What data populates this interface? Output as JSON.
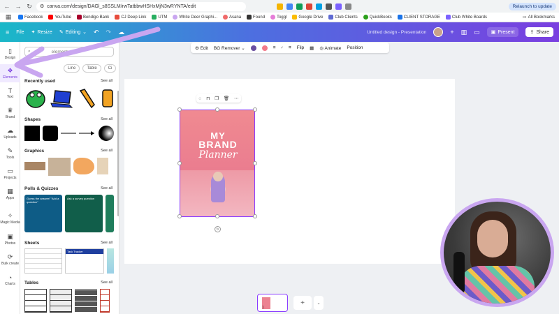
{
  "browser": {
    "url": "canva.com/design/DAGl_s8SSLM/rwTatbbwHSHxMjN3wRYNTA/edit",
    "relaunch": "Relaunch to update",
    "bookmarks": [
      {
        "label": "Facebook",
        "color": "#1877f2"
      },
      {
        "label": "YouTube",
        "color": "#ff0000"
      },
      {
        "label": "Bendigo Bank",
        "color": "#a8002b"
      },
      {
        "label": "CJ Deep Link",
        "color": "#e74c3c"
      },
      {
        "label": "UTM",
        "color": "#27ae60"
      },
      {
        "label": "White Deer Graphi...",
        "color": "#c9a6f0"
      },
      {
        "label": "Asana",
        "color": "#f06a6a"
      },
      {
        "label": "Found",
        "color": "#333333"
      },
      {
        "label": "Toggl",
        "color": "#e57cd8"
      },
      {
        "label": "Google Drive",
        "color": "#fbbc04"
      },
      {
        "label": "Club Clients",
        "color": "#5e6ad2"
      },
      {
        "label": "QuickBooks",
        "color": "#2ca01c"
      },
      {
        "label": "CLIENT STORAGE",
        "color": "#1a73e8"
      },
      {
        "label": "Club White Boards",
        "color": "#7b61ff"
      }
    ],
    "all_bookmarks": "All Bookmarks"
  },
  "header": {
    "file": "File",
    "resize": "Resize",
    "editing": "Editing",
    "title": "Untitled design - Presentation",
    "present": "Present",
    "share": "Share",
    "gradient_start": "#1ab8c8",
    "gradient_end": "#7a3fe0"
  },
  "rail": [
    {
      "label": "Design",
      "icon": "layout-icon"
    },
    {
      "label": "Elements",
      "icon": "shapes-icon"
    },
    {
      "label": "Text",
      "icon": "text-icon"
    },
    {
      "label": "Brand",
      "icon": "brand-icon"
    },
    {
      "label": "Uploads",
      "icon": "upload-icon"
    },
    {
      "label": "Tools",
      "icon": "tools-icon"
    },
    {
      "label": "Projects",
      "icon": "folder-icon"
    },
    {
      "label": "Apps",
      "icon": "apps-icon"
    },
    {
      "label": "Magic Media",
      "icon": "magic-icon"
    },
    {
      "label": "Photos",
      "icon": "photo-icon"
    },
    {
      "label": "Bulk create",
      "icon": "bulk-icon"
    },
    {
      "label": "Charts",
      "icon": "chart-icon"
    }
  ],
  "panel": {
    "search_placeholder": "elements",
    "chips": [
      "Line",
      "Table",
      "Ci"
    ],
    "sections": {
      "recently_used": "Recently used",
      "shapes": "Shapes",
      "graphics": "Graphics",
      "polls": "Polls & Quizzes",
      "sheets": "Sheets",
      "tables": "Tables",
      "see_all": "See all"
    },
    "polls": {
      "card1": "Guess the answer! \"Add a question\"",
      "card2": "Ask a survey question"
    },
    "sheet_title": "Task Tracker"
  },
  "toolbar": {
    "edit": "Edit",
    "bg_remover": "BG Remover",
    "flip": "Flip",
    "animate": "Animate",
    "position": "Position",
    "color1": "#6b4fa0",
    "color2": "#f27a8a"
  },
  "design": {
    "line1": "MY",
    "line2": "BRAND",
    "line3": "Planner"
  },
  "pages": {
    "page_number": "1"
  }
}
